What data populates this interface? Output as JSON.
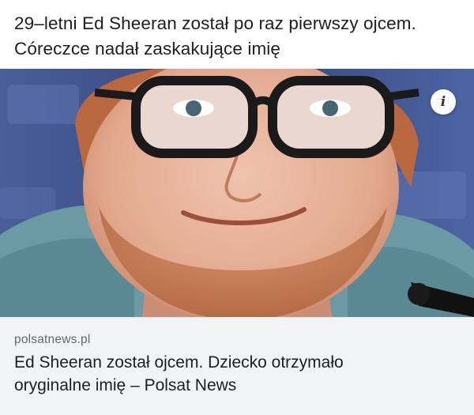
{
  "post": {
    "text_lines": [
      "29–letni Ed Sheeran został po raz pierwszy ojcem.",
      "Córeczce nadał zaskakujące imię"
    ]
  },
  "link_card": {
    "domain": "polsatnews.pl",
    "title_lines": [
      "Ed Sheeran został ojcem. Dziecko otrzymało",
      "oryginalne imię – Polsat News"
    ],
    "info_glyph": "i",
    "info_icon": "info-icon"
  },
  "colors": {
    "text": "#1c1e21",
    "domain_text": "#65676b",
    "card_background": "#f2f3f5",
    "photo_background": "#3c4f86"
  }
}
